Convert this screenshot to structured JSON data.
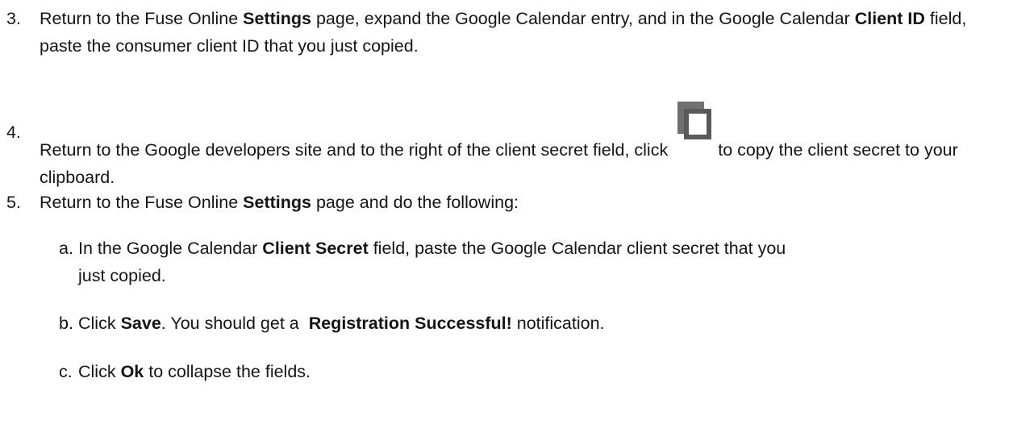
{
  "steps": [
    {
      "number": "3.",
      "parts": [
        "Return to the Fuse Online ",
        "Settings",
        " page, expand the Google Calendar entry, and in the Google Calendar ",
        "Client ID",
        " field, paste the consumer client ID that you just copied."
      ]
    },
    {
      "number": "4.",
      "parts": [
        "Return to the Google developers site and to the right of the client secret field, click",
        "to copy the client secret to your clipboard."
      ],
      "icon": "copy-icon"
    },
    {
      "number": "5.",
      "parts": [
        "Return to the Fuse Online ",
        "Settings",
        " page and do the following:"
      ],
      "substeps": [
        {
          "letter": "a.",
          "parts": [
            "In the Google Calendar ",
            "Client Secret",
            " field, paste the Google Calendar client secret that you just copied."
          ]
        },
        {
          "letter": "b.",
          "parts": [
            "Click ",
            "Save",
            ". You should get a  ",
            "Registration Successful!",
            " notification."
          ]
        },
        {
          "letter": "c.",
          "parts": [
            "Click ",
            "Ok",
            " to collapse the fields."
          ]
        }
      ]
    }
  ],
  "colors": {
    "text": "#151515",
    "icon": "#6a6a6a"
  }
}
